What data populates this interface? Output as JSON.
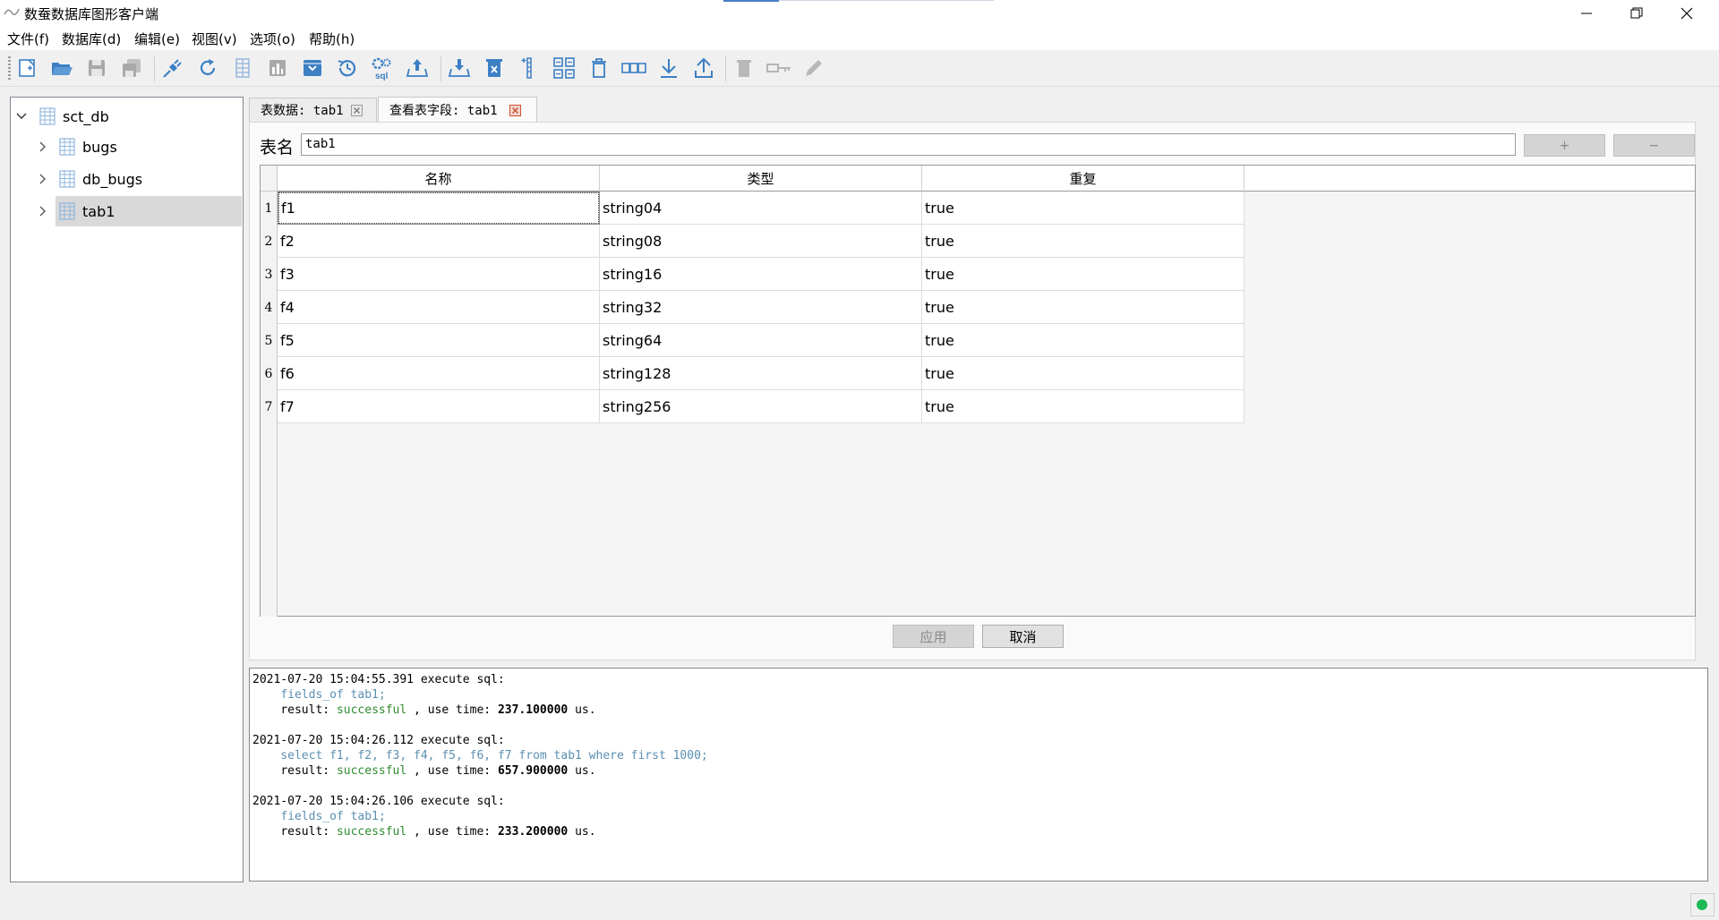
{
  "window": {
    "title": "数蚕数据库图形客户端"
  },
  "menu": {
    "items": [
      {
        "name": "menu-file",
        "label": "文件(f)"
      },
      {
        "name": "menu-database",
        "label": "数据库(d)"
      },
      {
        "name": "menu-edit",
        "label": "编辑(e)"
      },
      {
        "name": "menu-view",
        "label": "视图(v)"
      },
      {
        "name": "menu-options",
        "label": "选项(o)"
      },
      {
        "name": "menu-help",
        "label": "帮助(h)"
      }
    ]
  },
  "toolbar": {
    "icons": [
      "new-file-icon",
      "open-folder-icon",
      "save-icon",
      "save-all-icon",
      "connect-icon",
      "refresh-icon",
      "table-icon",
      "chart-icon",
      "archive-icon",
      "history-icon",
      "sql-settings-icon",
      "upload-icon",
      "import-icon",
      "delete-table-icon",
      "column-icon",
      "layout-icon",
      "trash-icon",
      "link-icon",
      "download-icon",
      "export-icon",
      "delete-disabled-icon",
      "key-disabled-icon",
      "edit-disabled-icon"
    ]
  },
  "tree": {
    "root": "sct_db",
    "children": [
      {
        "label": "bugs"
      },
      {
        "label": "db_bugs"
      },
      {
        "label": "tab1",
        "selected": true
      }
    ]
  },
  "tabs": [
    {
      "label": "表数据: tab1",
      "active": false
    },
    {
      "label": "查看表字段: tab1",
      "active": true
    }
  ],
  "form": {
    "name_label": "表名",
    "name_value": "tab1",
    "add_label": "+",
    "remove_label": "−"
  },
  "table": {
    "headers": [
      "名称",
      "类型",
      "重复"
    ],
    "rows": [
      {
        "num": "1",
        "name": "f1",
        "type": "string04",
        "repeat": "true"
      },
      {
        "num": "2",
        "name": "f2",
        "type": "string08",
        "repeat": "true"
      },
      {
        "num": "3",
        "name": "f3",
        "type": "string16",
        "repeat": "true"
      },
      {
        "num": "4",
        "name": "f4",
        "type": "string32",
        "repeat": "true"
      },
      {
        "num": "5",
        "name": "f5",
        "type": "string64",
        "repeat": "true"
      },
      {
        "num": "6",
        "name": "f6",
        "type": "string128",
        "repeat": "true"
      },
      {
        "num": "7",
        "name": "f7",
        "type": "string256",
        "repeat": "true"
      }
    ]
  },
  "actions": {
    "apply": "应用",
    "cancel": "取消"
  },
  "log": [
    {
      "header": "2021-07-20 15:04:55.391 execute sql:",
      "sql": "fields_of tab1;",
      "result_prefix": "result: ",
      "result_status": "successful",
      "result_mid": " , use time: ",
      "time": "237.100000",
      "unit": " us."
    },
    {
      "header": "2021-07-20 15:04:26.112 execute sql:",
      "sql": "select f1, f2, f3, f4, f5, f6, f7 from tab1 where first 1000;",
      "result_prefix": "result: ",
      "result_status": "successful",
      "result_mid": " , use time: ",
      "time": "657.900000",
      "unit": " us."
    },
    {
      "header": "2021-07-20 15:04:26.106 execute sql:",
      "sql": "fields_of tab1;",
      "result_prefix": "result: ",
      "result_status": "successful",
      "result_mid": " , use time: ",
      "time": "233.200000",
      "unit": " us."
    }
  ],
  "colors": {
    "status_ok": "#1db954",
    "sql_text": "#5b8fb1",
    "success_text": "#2e8b2e",
    "icon_blue": "#3c7fc4"
  }
}
